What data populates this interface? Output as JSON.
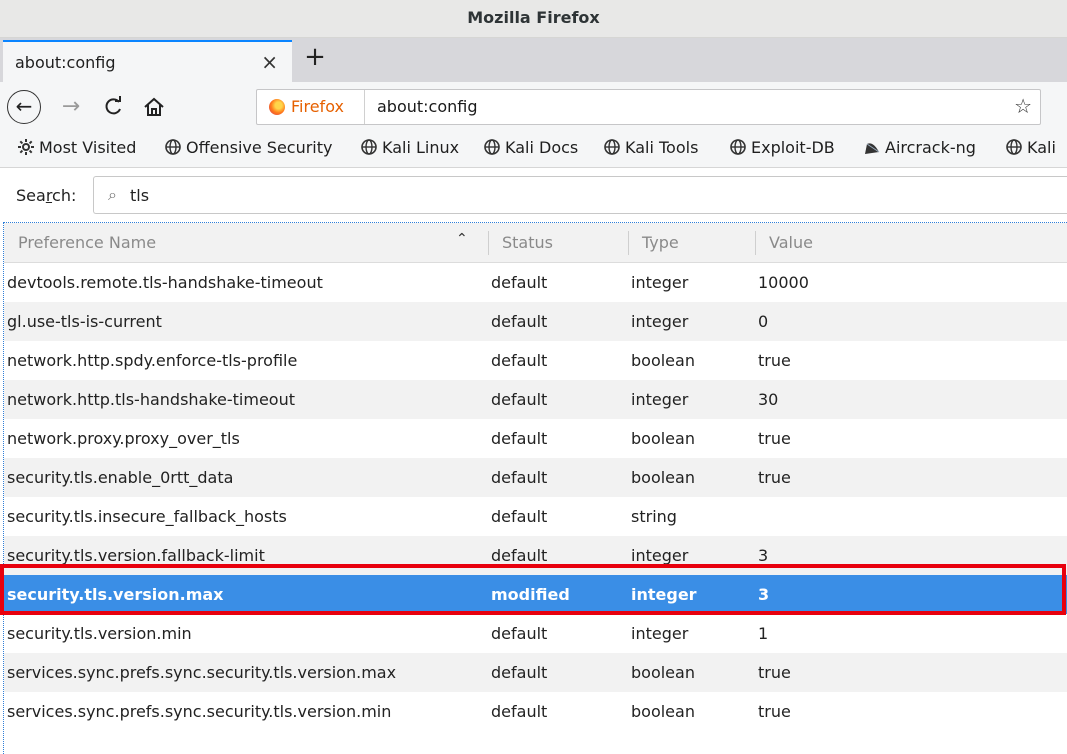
{
  "window": {
    "title": "Mozilla Firefox"
  },
  "tab": {
    "label": "about:config",
    "close_glyph": "×",
    "new_tab_glyph": "+"
  },
  "nav": {
    "back_icon": "back-arrow-icon",
    "back_glyph": "←",
    "forward_icon": "forward-arrow-icon",
    "forward_glyph": "→",
    "reload_icon": "reload-icon",
    "reload_glyph": "C",
    "home_icon": "home-icon",
    "home_glyph": "⌂"
  },
  "urlbar": {
    "identity": "Firefox",
    "url": "about:config",
    "star_glyph": "☆"
  },
  "bookmarks": [
    {
      "label": "Most Visited",
      "icon": "gear-icon"
    },
    {
      "label": "Offensive Security",
      "icon": "globe-icon"
    },
    {
      "label": "Kali Linux",
      "icon": "globe-icon"
    },
    {
      "label": "Kali Docs",
      "icon": "globe-icon"
    },
    {
      "label": "Kali Tools",
      "icon": "globe-icon"
    },
    {
      "label": "Exploit-DB",
      "icon": "globe-icon"
    },
    {
      "label": "Aircrack-ng",
      "icon": "aircrack-icon"
    },
    {
      "label": "Kali",
      "icon": "globe-icon"
    }
  ],
  "search": {
    "label_before": "Sea",
    "label_underlined": "r",
    "label_after": "ch:",
    "value": "tls",
    "icon_glyph": "⌕"
  },
  "table": {
    "headers": {
      "name": "Preference Name",
      "status": "Status",
      "type": "Type",
      "value": "Value"
    },
    "sort_glyph": "⌃",
    "rows": [
      {
        "name": "devtools.remote.tls-handshake-timeout",
        "status": "default",
        "type": "integer",
        "value": "10000"
      },
      {
        "name": "gl.use-tls-is-current",
        "status": "default",
        "type": "integer",
        "value": "0"
      },
      {
        "name": "network.http.spdy.enforce-tls-profile",
        "status": "default",
        "type": "boolean",
        "value": "true"
      },
      {
        "name": "network.http.tls-handshake-timeout",
        "status": "default",
        "type": "integer",
        "value": "30"
      },
      {
        "name": "network.proxy.proxy_over_tls",
        "status": "default",
        "type": "boolean",
        "value": "true"
      },
      {
        "name": "security.tls.enable_0rtt_data",
        "status": "default",
        "type": "boolean",
        "value": "true"
      },
      {
        "name": "security.tls.insecure_fallback_hosts",
        "status": "default",
        "type": "string",
        "value": ""
      },
      {
        "name": "security.tls.version.fallback-limit",
        "status": "default",
        "type": "integer",
        "value": "3"
      },
      {
        "name": "security.tls.version.max",
        "status": "modified",
        "type": "integer",
        "value": "3"
      },
      {
        "name": "security.tls.version.min",
        "status": "default",
        "type": "integer",
        "value": "1"
      },
      {
        "name": "services.sync.prefs.sync.security.tls.version.max",
        "status": "default",
        "type": "boolean",
        "value": "true"
      },
      {
        "name": "services.sync.prefs.sync.security.tls.version.min",
        "status": "default",
        "type": "boolean",
        "value": "true"
      }
    ]
  },
  "colors": {
    "selection": "#3a8ee6",
    "highlight_box": "#e8000d",
    "identity": "#e66000"
  }
}
